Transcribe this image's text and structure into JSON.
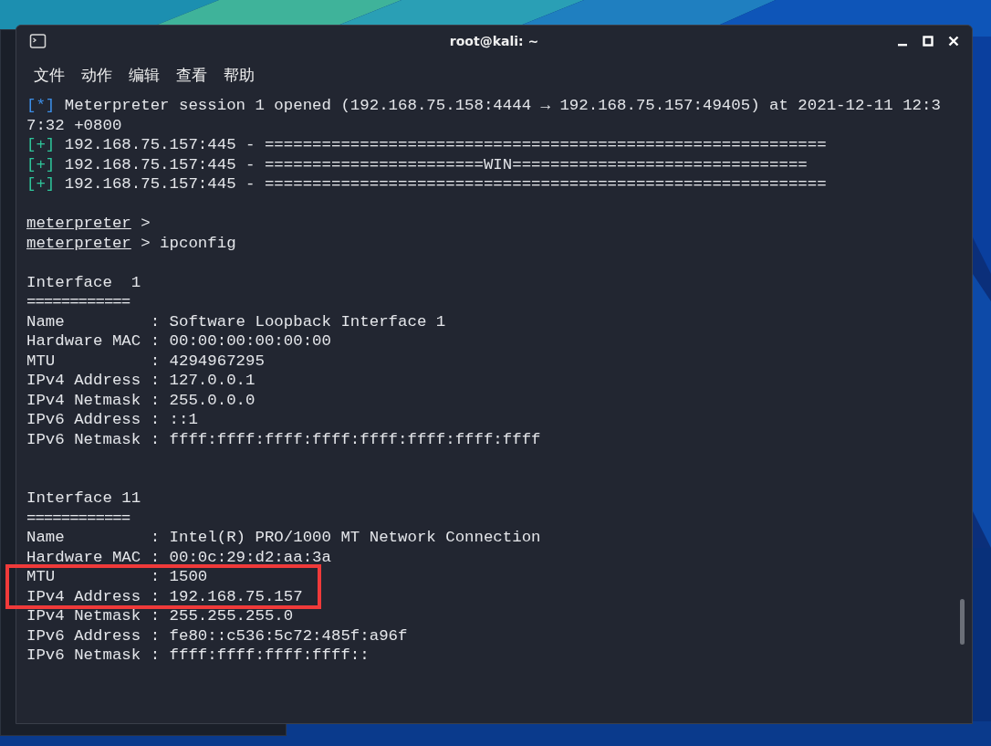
{
  "window": {
    "title": "root@kali: ~"
  },
  "menu": [
    {
      "label": "文件"
    },
    {
      "label": "动作"
    },
    {
      "label": "编辑"
    },
    {
      "label": "查看"
    },
    {
      "label": "帮助"
    }
  ],
  "lines": [
    {
      "kind": "status",
      "prefix": "[*]",
      "color": "#3d8fe8",
      "text": "Meterpreter session 1 opened (192.168.75.158:4444 → 192.168.75.157:49405) at 2021-12-11 12:3"
    },
    {
      "kind": "plain",
      "text": "7:32 +0800"
    },
    {
      "kind": "status",
      "prefix": "[+]",
      "color": "#2fc49a",
      "text": "192.168.75.157:445 - ==========================================================="
    },
    {
      "kind": "status",
      "prefix": "[+]",
      "color": "#2fc49a",
      "text": "192.168.75.157:445 - =======================WIN==============================="
    },
    {
      "kind": "status",
      "prefix": "[+]",
      "color": "#2fc49a",
      "text": "192.168.75.157:445 - ==========================================================="
    },
    {
      "kind": "blank"
    },
    {
      "kind": "prompt",
      "prompt": "meterpreter",
      "text": ">"
    },
    {
      "kind": "prompt",
      "prompt": "meterpreter",
      "text": "> ipconfig"
    },
    {
      "kind": "blank"
    },
    {
      "kind": "plain",
      "text": "Interface  1"
    },
    {
      "kind": "rule",
      "text": "============"
    },
    {
      "kind": "field",
      "label": "Name         :",
      "value": "Software Loopback Interface 1",
      "highlighted": false
    },
    {
      "kind": "field",
      "label": "Hardware MAC :",
      "value": "00:00:00:00:00:00",
      "highlighted": false
    },
    {
      "kind": "field",
      "label": "MTU          :",
      "value": "4294967295",
      "highlighted": false
    },
    {
      "kind": "field",
      "label": "IPv4 Address :",
      "value": "127.0.0.1",
      "highlighted": false
    },
    {
      "kind": "field",
      "label": "IPv4 Netmask :",
      "value": "255.0.0.0",
      "highlighted": false
    },
    {
      "kind": "field",
      "label": "IPv6 Address :",
      "value": "::1",
      "highlighted": false
    },
    {
      "kind": "field",
      "label": "IPv6 Netmask :",
      "value": "ffff:ffff:ffff:ffff:ffff:ffff:ffff:ffff",
      "highlighted": false
    },
    {
      "kind": "blank"
    },
    {
      "kind": "blank"
    },
    {
      "kind": "plain",
      "text": "Interface 11"
    },
    {
      "kind": "rule",
      "text": "============"
    },
    {
      "kind": "field",
      "label": "Name         :",
      "value": "Intel(R) PRO/1000 MT Network Connection",
      "highlighted": false
    },
    {
      "kind": "field",
      "label": "Hardware MAC :",
      "value": "00:0c:29:d2:aa:3a",
      "highlighted": false
    },
    {
      "kind": "field",
      "label": "MTU          :",
      "value": "1500",
      "highlighted": true
    },
    {
      "kind": "field",
      "label": "IPv4 Address :",
      "value": "192.168.75.157",
      "highlighted": true
    },
    {
      "kind": "field",
      "label": "IPv4 Netmask :",
      "value": "255.255.255.0",
      "highlighted": false
    },
    {
      "kind": "field",
      "label": "IPv6 Address :",
      "value": "fe80::c536:5c72:485f:a96f",
      "highlighted": false
    },
    {
      "kind": "field",
      "label": "IPv6 Netmask :",
      "value": "ffff:ffff:ffff:ffff::",
      "highlighted": false
    }
  ]
}
